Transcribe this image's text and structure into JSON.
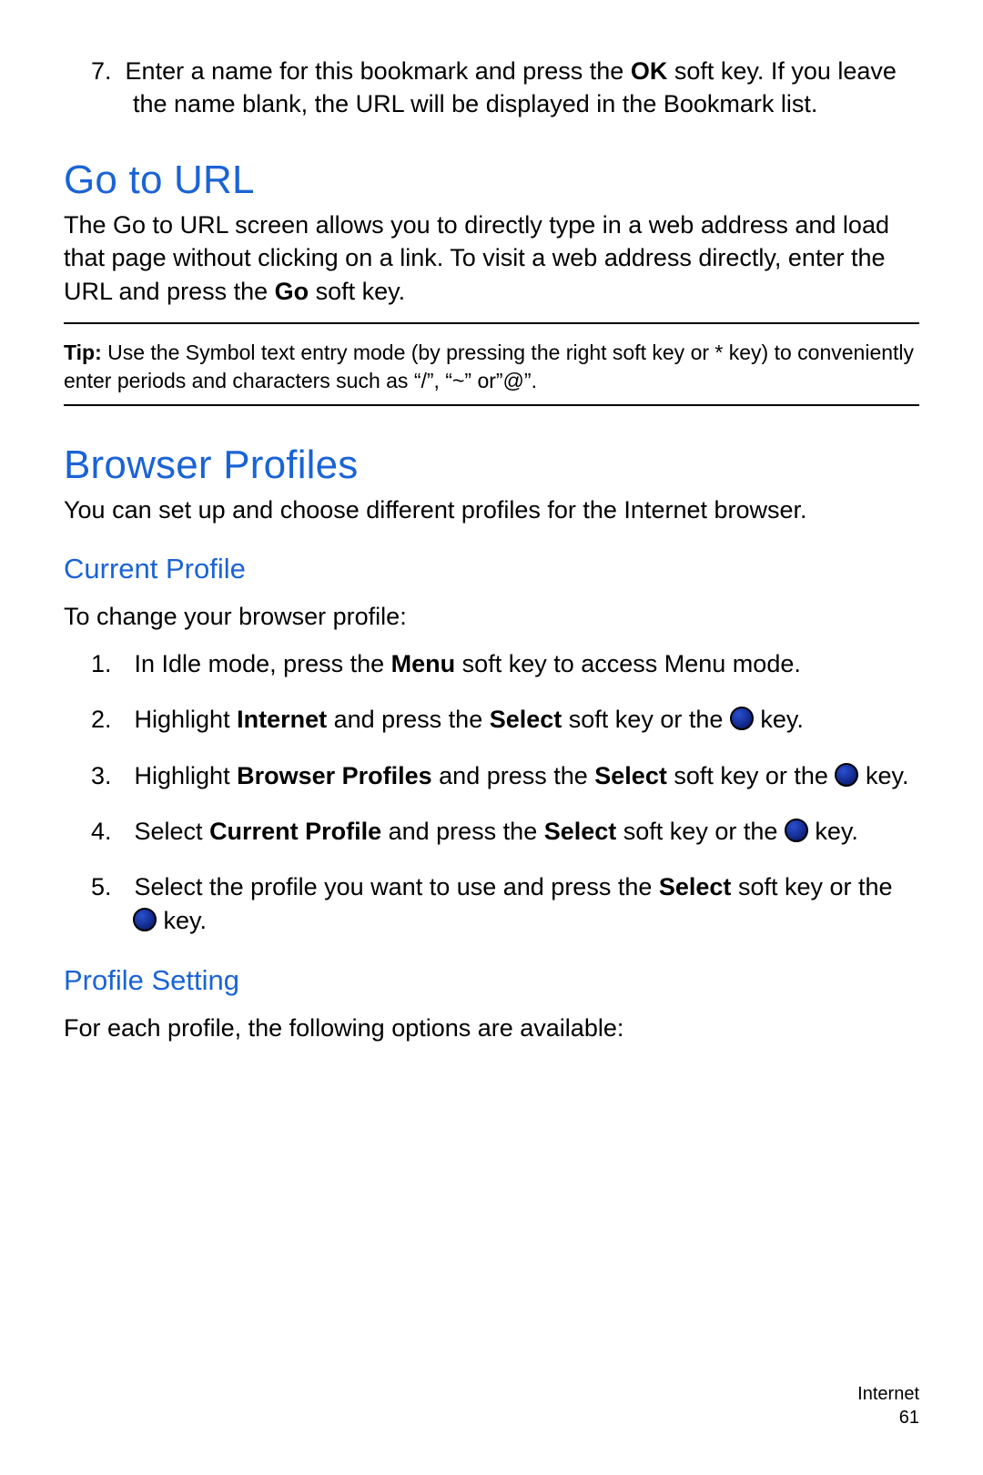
{
  "step7": {
    "num": "7.",
    "text_a": "Enter a name for this bookmark and press the ",
    "text_b": "OK",
    "text_c": " soft key. If you leave the name blank, the URL will be displayed in the Bookmark list."
  },
  "go_to_url": {
    "heading": "Go to URL",
    "body_a": "The Go to URL screen allows you to directly type in a web address and load that page without clicking on a link. To visit a web address directly, enter the URL and press the ",
    "body_b": "Go",
    "body_c": " soft key."
  },
  "tip": {
    "label": "Tip:",
    "text": " Use the Symbol text entry mode (by pressing the right soft key or * key) to conveniently enter periods and characters such as “/”, “~” or”@”."
  },
  "browser_profiles": {
    "heading": "Browser Profiles",
    "body": "You can set up and choose different profiles for the Internet browser."
  },
  "current_profile": {
    "heading": "Current Profile",
    "intro": "To change your browser profile:",
    "steps": {
      "s1_a": "In Idle mode, press the ",
      "s1_b": "Menu",
      "s1_c": " soft key to access Menu mode.",
      "s2_a": "Highlight ",
      "s2_b": "Internet",
      "s2_c": " and press the ",
      "s2_d": "Select",
      "s2_e": " soft key or the ",
      "s2_f": " key.",
      "s3_a": "Highlight ",
      "s3_b": "Browser Profiles",
      "s3_c": " and press the ",
      "s3_d": "Select",
      "s3_e": " soft key or the ",
      "s3_f": " key.",
      "s4_a": "Select ",
      "s4_b": "Current Profile",
      "s4_c": " and press the ",
      "s4_d": "Select",
      "s4_e": " soft key or the ",
      "s4_f": " key.",
      "s5_a": "Select the profile you want to use and press the ",
      "s5_b": "Select",
      "s5_c": " soft key or the ",
      "s5_d": " key."
    }
  },
  "profile_setting": {
    "heading": "Profile Setting",
    "body": "For each profile, the following options are available:"
  },
  "footer": {
    "section": "Internet",
    "page": "61"
  }
}
